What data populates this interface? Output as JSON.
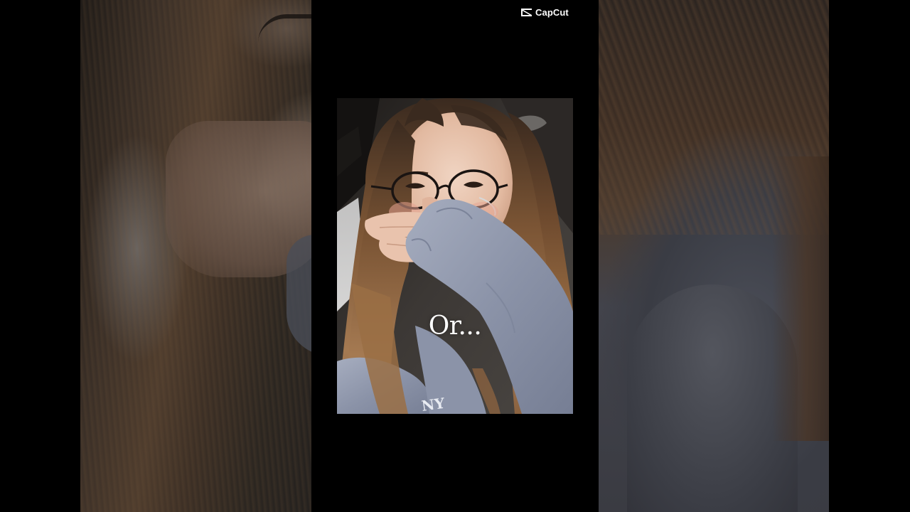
{
  "watermark": {
    "brand": "CapCut",
    "icon": "capcut-logo-icon"
  },
  "video": {
    "caption": "Or..."
  },
  "colors": {
    "background": "#000000",
    "caption_text": "#ffffff",
    "sweater": "#8b93a8",
    "hair": "#7a5434"
  }
}
